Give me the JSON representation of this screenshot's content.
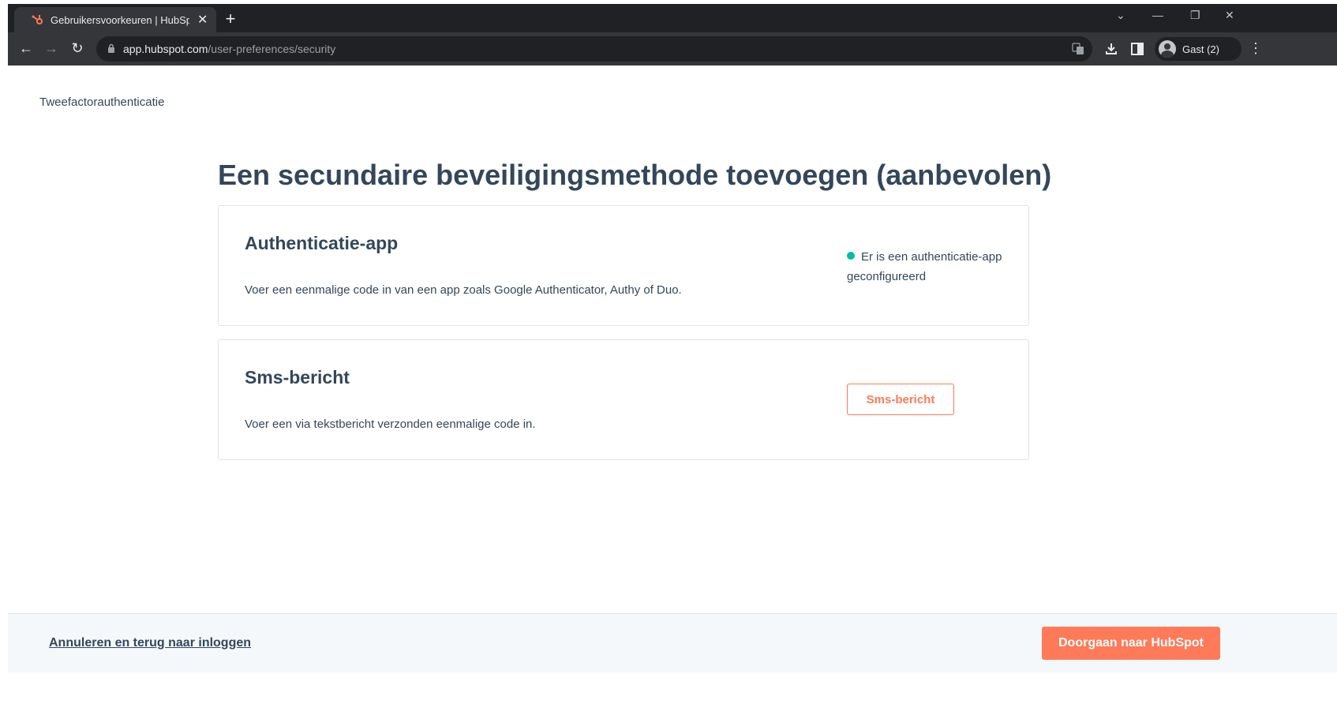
{
  "browser": {
    "tab_title": "Gebruikersvoorkeuren | HubSpot",
    "tab_close": "✕",
    "new_tab": "+",
    "url_host": "app.hubspot.com",
    "url_path": "/user-preferences/security",
    "profile_name": "Gast (2)",
    "window_controls": [
      "⌄",
      "—",
      "❐",
      "✕"
    ],
    "nav": {
      "back": "←",
      "forward": "→",
      "reload": "↻",
      "menu": "⋮"
    }
  },
  "page": {
    "breadcrumb": "Tweefactorauthenticatie",
    "heading": "Een secundaire beveiligingsmethode toevoegen (aanbevolen)",
    "cards": [
      {
        "title": "Authenticatie-app",
        "description": "Voer een eenmalige code in van een app zoals Google Authenticator, Authy of Duo.",
        "status": "Er is een authenticatie-app geconfigureerd"
      },
      {
        "title": "Sms-bericht",
        "description": "Voer een via tekstbericht verzonden eenmalige code in.",
        "button_label": "Sms-bericht"
      }
    ],
    "footer": {
      "cancel_link": "Annuleren en terug naar inloggen",
      "continue_button": "Doorgaan naar HubSpot"
    }
  },
  "colors": {
    "accent": "#ff7a59",
    "text": "#33475b",
    "status_ok": "#00bda5",
    "border": "#dfe3eb"
  }
}
